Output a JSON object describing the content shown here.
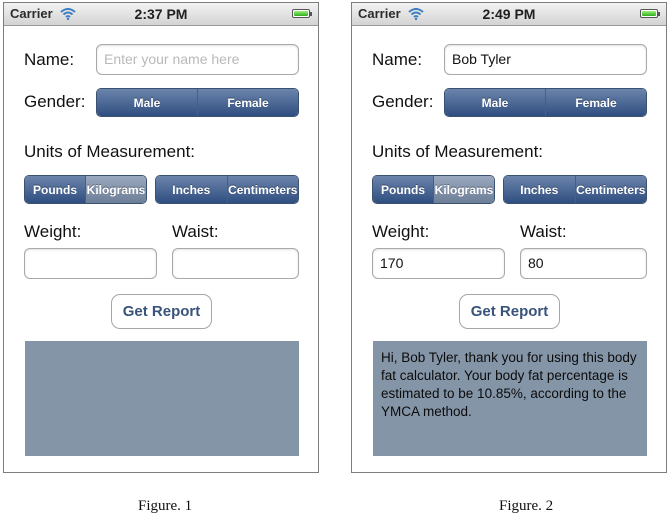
{
  "screens": [
    {
      "status": {
        "carrier": "Carrier",
        "time": "2:37 PM"
      },
      "name_label": "Name:",
      "name_value": "",
      "name_placeholder": "Enter your name here",
      "gender_label": "Gender:",
      "gender_options": [
        "Male",
        "Female"
      ],
      "gender_selected": "Male",
      "units_label": "Units of Measurement:",
      "weight_units": [
        "Pounds",
        "Kilograms"
      ],
      "weight_unit_selected": "Pounds",
      "length_units": [
        "Inches",
        "Centimeters"
      ],
      "length_unit_selected": "Inches",
      "weight_label": "Weight:",
      "weight_value": "",
      "waist_label": "Waist:",
      "waist_value": "",
      "report_button": "Get Report",
      "result_text": "",
      "caption": "Figure. 1"
    },
    {
      "status": {
        "carrier": "Carrier",
        "time": "2:49 PM"
      },
      "name_label": "Name:",
      "name_value": "Bob Tyler",
      "name_placeholder": "Enter your name here",
      "gender_label": "Gender:",
      "gender_options": [
        "Male",
        "Female"
      ],
      "gender_selected": "Male",
      "units_label": "Units of Measurement:",
      "weight_units": [
        "Pounds",
        "Kilograms"
      ],
      "weight_unit_selected": "Pounds",
      "length_units": [
        "Inches",
        "Centimeters"
      ],
      "length_unit_selected": "Inches",
      "weight_label": "Weight:",
      "weight_value": "170",
      "waist_label": "Waist:",
      "waist_value": "80",
      "report_button": "Get Report",
      "result_text": "Hi, Bob Tyler, thank you for using this body fat calculator. Your body fat percentage is estimated to be 10.85%, according to the YMCA method.",
      "caption": "Figure. 2"
    }
  ],
  "colors": {
    "segment_selected": "#2f4e80",
    "segment_unselected": "#6d7e98",
    "result_background": "#8595a8",
    "button_text": "#39537b"
  },
  "icons": {
    "signal": "wifi-icon",
    "battery": "battery-icon"
  }
}
